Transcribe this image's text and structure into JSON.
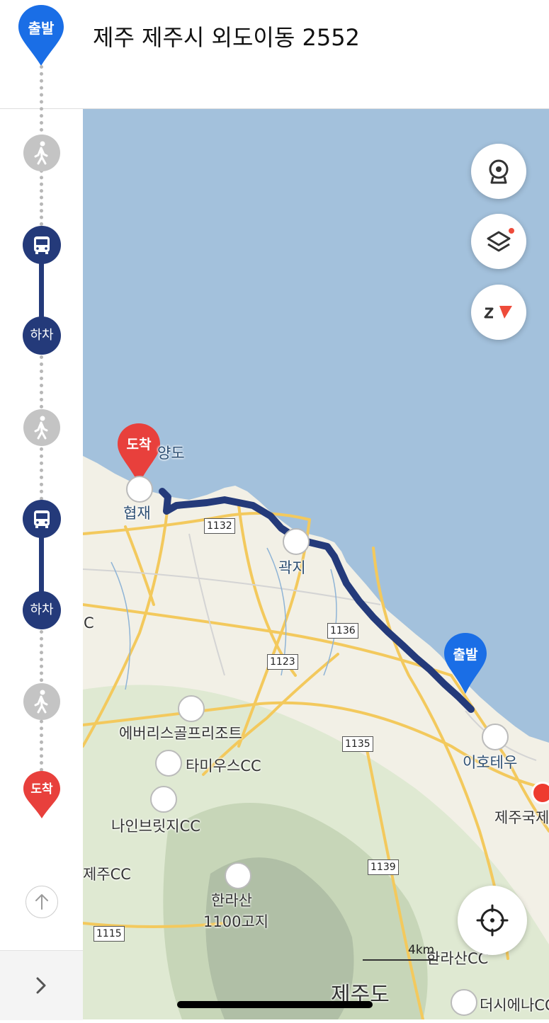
{
  "header": {
    "title": "제주 제주시 외도이동 2552",
    "start_badge": "출발"
  },
  "sidebar": {
    "steps": [
      {
        "type": "walk",
        "icon": "walk-icon"
      },
      {
        "type": "bus",
        "icon": "bus-icon"
      },
      {
        "type": "alight",
        "label": "하차"
      },
      {
        "type": "walk",
        "icon": "walk-icon"
      },
      {
        "type": "bus",
        "icon": "bus-icon"
      },
      {
        "type": "alight",
        "label": "하차"
      },
      {
        "type": "walk",
        "icon": "walk-icon"
      }
    ],
    "alight_label_1": "하차",
    "alight_label_2": "하차",
    "end_badge": "도착",
    "scroll_top_icon": "arrow-up-icon",
    "expand_icon": "chevron-right-icon"
  },
  "map": {
    "buttons": {
      "roadview_icon": "roadview-icon",
      "layers_icon": "layers-icon",
      "compass_icon": "compass-icon",
      "locate_icon": "current-location-icon"
    },
    "pins": {
      "arrival": "도착",
      "departure": "출발"
    },
    "labels": {
      "place_1": "양도",
      "place_2": "협재",
      "place_3": "곽지",
      "place_4": "이호테우",
      "place_5": "제주국제",
      "golf_1": "에버리스골프리조트",
      "golf_2": "타미우스CC",
      "golf_3": "나인브릿지CC",
      "golf_4": "제주CC",
      "golf_5": "한라산CC",
      "golf_6": "더시에나CC",
      "mountain": "한라산",
      "mountain_sub": "1100고지",
      "island": "제주도",
      "edge_c": "C"
    },
    "roads": {
      "r1": "1132",
      "r2": "1136",
      "r3": "1123",
      "r4": "1135",
      "r5": "1139",
      "r6": "1115"
    },
    "scale_label": "4km"
  },
  "colors": {
    "route": "#243a7a",
    "departure_pin": "#1a6ee6",
    "arrival_pin": "#e8403c",
    "sea": "#a3c1dc",
    "land": "#f2f0e6"
  }
}
